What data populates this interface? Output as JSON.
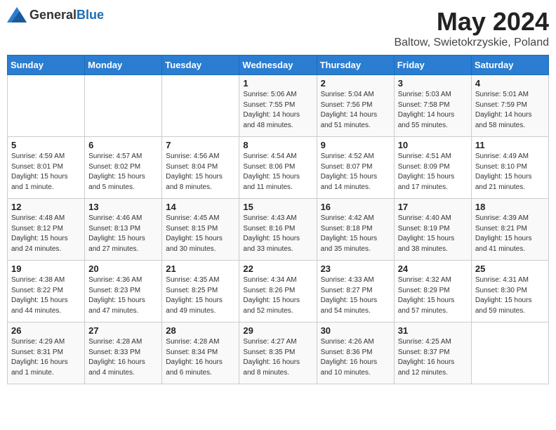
{
  "logo": {
    "general": "General",
    "blue": "Blue"
  },
  "title": "May 2024",
  "location": "Baltow, Swietokrzyskie, Poland",
  "days_of_week": [
    "Sunday",
    "Monday",
    "Tuesday",
    "Wednesday",
    "Thursday",
    "Friday",
    "Saturday"
  ],
  "weeks": [
    [
      {
        "day": "",
        "info": ""
      },
      {
        "day": "",
        "info": ""
      },
      {
        "day": "",
        "info": ""
      },
      {
        "day": "1",
        "info": "Sunrise: 5:06 AM\nSunset: 7:55 PM\nDaylight: 14 hours\nand 48 minutes."
      },
      {
        "day": "2",
        "info": "Sunrise: 5:04 AM\nSunset: 7:56 PM\nDaylight: 14 hours\nand 51 minutes."
      },
      {
        "day": "3",
        "info": "Sunrise: 5:03 AM\nSunset: 7:58 PM\nDaylight: 14 hours\nand 55 minutes."
      },
      {
        "day": "4",
        "info": "Sunrise: 5:01 AM\nSunset: 7:59 PM\nDaylight: 14 hours\nand 58 minutes."
      }
    ],
    [
      {
        "day": "5",
        "info": "Sunrise: 4:59 AM\nSunset: 8:01 PM\nDaylight: 15 hours\nand 1 minute."
      },
      {
        "day": "6",
        "info": "Sunrise: 4:57 AM\nSunset: 8:02 PM\nDaylight: 15 hours\nand 5 minutes."
      },
      {
        "day": "7",
        "info": "Sunrise: 4:56 AM\nSunset: 8:04 PM\nDaylight: 15 hours\nand 8 minutes."
      },
      {
        "day": "8",
        "info": "Sunrise: 4:54 AM\nSunset: 8:06 PM\nDaylight: 15 hours\nand 11 minutes."
      },
      {
        "day": "9",
        "info": "Sunrise: 4:52 AM\nSunset: 8:07 PM\nDaylight: 15 hours\nand 14 minutes."
      },
      {
        "day": "10",
        "info": "Sunrise: 4:51 AM\nSunset: 8:09 PM\nDaylight: 15 hours\nand 17 minutes."
      },
      {
        "day": "11",
        "info": "Sunrise: 4:49 AM\nSunset: 8:10 PM\nDaylight: 15 hours\nand 21 minutes."
      }
    ],
    [
      {
        "day": "12",
        "info": "Sunrise: 4:48 AM\nSunset: 8:12 PM\nDaylight: 15 hours\nand 24 minutes."
      },
      {
        "day": "13",
        "info": "Sunrise: 4:46 AM\nSunset: 8:13 PM\nDaylight: 15 hours\nand 27 minutes."
      },
      {
        "day": "14",
        "info": "Sunrise: 4:45 AM\nSunset: 8:15 PM\nDaylight: 15 hours\nand 30 minutes."
      },
      {
        "day": "15",
        "info": "Sunrise: 4:43 AM\nSunset: 8:16 PM\nDaylight: 15 hours\nand 33 minutes."
      },
      {
        "day": "16",
        "info": "Sunrise: 4:42 AM\nSunset: 8:18 PM\nDaylight: 15 hours\nand 35 minutes."
      },
      {
        "day": "17",
        "info": "Sunrise: 4:40 AM\nSunset: 8:19 PM\nDaylight: 15 hours\nand 38 minutes."
      },
      {
        "day": "18",
        "info": "Sunrise: 4:39 AM\nSunset: 8:21 PM\nDaylight: 15 hours\nand 41 minutes."
      }
    ],
    [
      {
        "day": "19",
        "info": "Sunrise: 4:38 AM\nSunset: 8:22 PM\nDaylight: 15 hours\nand 44 minutes."
      },
      {
        "day": "20",
        "info": "Sunrise: 4:36 AM\nSunset: 8:23 PM\nDaylight: 15 hours\nand 47 minutes."
      },
      {
        "day": "21",
        "info": "Sunrise: 4:35 AM\nSunset: 8:25 PM\nDaylight: 15 hours\nand 49 minutes."
      },
      {
        "day": "22",
        "info": "Sunrise: 4:34 AM\nSunset: 8:26 PM\nDaylight: 15 hours\nand 52 minutes."
      },
      {
        "day": "23",
        "info": "Sunrise: 4:33 AM\nSunset: 8:27 PM\nDaylight: 15 hours\nand 54 minutes."
      },
      {
        "day": "24",
        "info": "Sunrise: 4:32 AM\nSunset: 8:29 PM\nDaylight: 15 hours\nand 57 minutes."
      },
      {
        "day": "25",
        "info": "Sunrise: 4:31 AM\nSunset: 8:30 PM\nDaylight: 15 hours\nand 59 minutes."
      }
    ],
    [
      {
        "day": "26",
        "info": "Sunrise: 4:29 AM\nSunset: 8:31 PM\nDaylight: 16 hours\nand 1 minute."
      },
      {
        "day": "27",
        "info": "Sunrise: 4:28 AM\nSunset: 8:33 PM\nDaylight: 16 hours\nand 4 minutes."
      },
      {
        "day": "28",
        "info": "Sunrise: 4:28 AM\nSunset: 8:34 PM\nDaylight: 16 hours\nand 6 minutes."
      },
      {
        "day": "29",
        "info": "Sunrise: 4:27 AM\nSunset: 8:35 PM\nDaylight: 16 hours\nand 8 minutes."
      },
      {
        "day": "30",
        "info": "Sunrise: 4:26 AM\nSunset: 8:36 PM\nDaylight: 16 hours\nand 10 minutes."
      },
      {
        "day": "31",
        "info": "Sunrise: 4:25 AM\nSunset: 8:37 PM\nDaylight: 16 hours\nand 12 minutes."
      },
      {
        "day": "",
        "info": ""
      }
    ]
  ]
}
